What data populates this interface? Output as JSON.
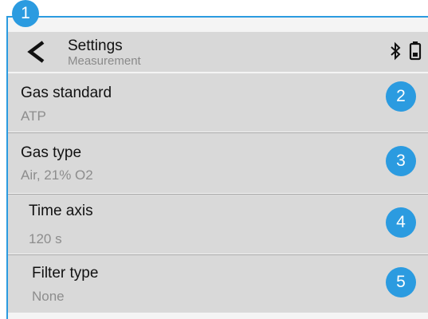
{
  "header": {
    "title": "Settings",
    "subtitle": "Measurement"
  },
  "icons": {
    "back": "chevron-left-icon",
    "bluetooth": "bluetooth-icon",
    "battery": "battery-icon"
  },
  "accent_color": "#2b9be0",
  "badges": [
    "1",
    "2",
    "3",
    "4",
    "5"
  ],
  "items": [
    {
      "label": "Gas standard",
      "value": "ATP"
    },
    {
      "label": "Gas type",
      "value": "Air, 21% O2"
    },
    {
      "label": "Time axis",
      "value": "120 s"
    },
    {
      "label": "Filter type",
      "value": "None"
    }
  ]
}
